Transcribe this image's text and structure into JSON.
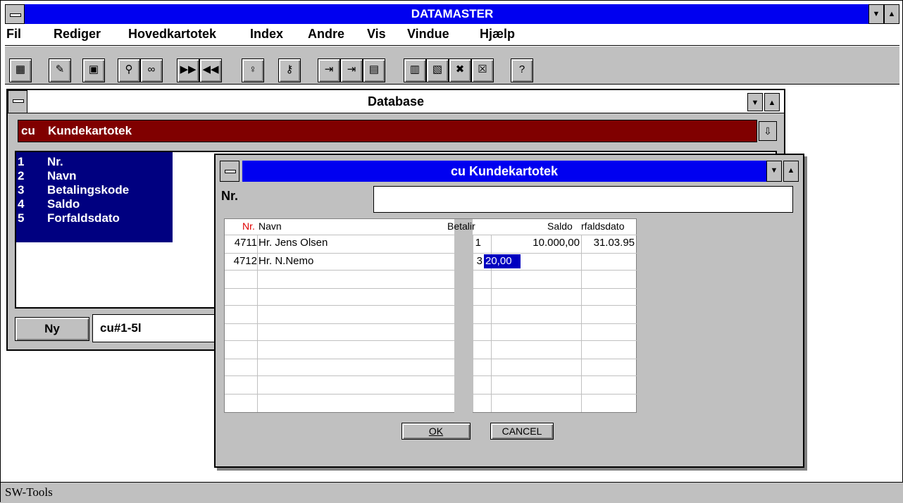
{
  "app": {
    "title": "DATAMASTER",
    "menu": [
      "Fil",
      "Rediger",
      "Hovedkartotek",
      "Index",
      "Andre",
      "Vis",
      "Vindue",
      "Hjælp"
    ],
    "toolbar": [
      "calculator-icon",
      "edit-icon",
      "save-icon",
      "search-icon",
      "glasses-icon",
      "next-record-icon",
      "previous-record-icon",
      "lightbulb-icon",
      "key-icon",
      "import-icon",
      "export-icon",
      "layout-icon",
      "window-icon",
      "windows-icon",
      "delete-window-icon",
      "close-window-icon",
      "help-icon"
    ]
  },
  "db_window": {
    "title": "Database",
    "selector_code": "cu",
    "selector_name": "Kundekartotek",
    "fields": [
      {
        "num": "1",
        "name": "Nr."
      },
      {
        "num": "2",
        "name": "Navn"
      },
      {
        "num": "3",
        "name": "Betalingskode"
      },
      {
        "num": "4",
        "name": "Saldo"
      },
      {
        "num": "5",
        "name": "Forfaldsdato"
      }
    ],
    "new_button": "Ny",
    "range_value": "cu#1-5l"
  },
  "dialog": {
    "title": "cu Kundekartotek",
    "field_label": "Nr.",
    "field_value": "",
    "columns": {
      "nr": "Nr.",
      "navn": "Navn",
      "betal": "Betalir",
      "saldo": "Saldo",
      "forfald": "rfaldsdato"
    },
    "rows": [
      {
        "nr": "4711",
        "navn": "Hr. Jens Olsen",
        "betal": "1",
        "saldo": "10.000,00",
        "forfald": "31.03.95"
      },
      {
        "nr": "4712",
        "navn": "Hr. N.Nemo",
        "betal": "3",
        "saldo": "20,00",
        "forfald": ""
      }
    ],
    "ok_label": "OK",
    "cancel_label": "CANCEL"
  },
  "status": "SW-Tools"
}
